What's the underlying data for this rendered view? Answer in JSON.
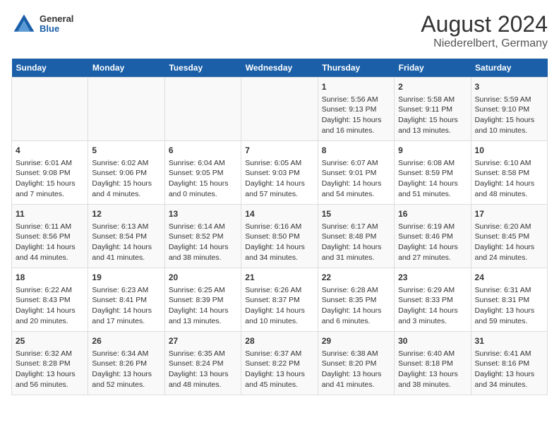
{
  "logo": {
    "general": "General",
    "blue": "Blue"
  },
  "title": "August 2024",
  "subtitle": "Niederelbert, Germany",
  "days_of_week": [
    "Sunday",
    "Monday",
    "Tuesday",
    "Wednesday",
    "Thursday",
    "Friday",
    "Saturday"
  ],
  "weeks": [
    [
      {
        "day": "",
        "info": ""
      },
      {
        "day": "",
        "info": ""
      },
      {
        "day": "",
        "info": ""
      },
      {
        "day": "",
        "info": ""
      },
      {
        "day": "1",
        "info": "Sunrise: 5:56 AM\nSunset: 9:13 PM\nDaylight: 15 hours and 16 minutes."
      },
      {
        "day": "2",
        "info": "Sunrise: 5:58 AM\nSunset: 9:11 PM\nDaylight: 15 hours and 13 minutes."
      },
      {
        "day": "3",
        "info": "Sunrise: 5:59 AM\nSunset: 9:10 PM\nDaylight: 15 hours and 10 minutes."
      }
    ],
    [
      {
        "day": "4",
        "info": "Sunrise: 6:01 AM\nSunset: 9:08 PM\nDaylight: 15 hours and 7 minutes."
      },
      {
        "day": "5",
        "info": "Sunrise: 6:02 AM\nSunset: 9:06 PM\nDaylight: 15 hours and 4 minutes."
      },
      {
        "day": "6",
        "info": "Sunrise: 6:04 AM\nSunset: 9:05 PM\nDaylight: 15 hours and 0 minutes."
      },
      {
        "day": "7",
        "info": "Sunrise: 6:05 AM\nSunset: 9:03 PM\nDaylight: 14 hours and 57 minutes."
      },
      {
        "day": "8",
        "info": "Sunrise: 6:07 AM\nSunset: 9:01 PM\nDaylight: 14 hours and 54 minutes."
      },
      {
        "day": "9",
        "info": "Sunrise: 6:08 AM\nSunset: 8:59 PM\nDaylight: 14 hours and 51 minutes."
      },
      {
        "day": "10",
        "info": "Sunrise: 6:10 AM\nSunset: 8:58 PM\nDaylight: 14 hours and 48 minutes."
      }
    ],
    [
      {
        "day": "11",
        "info": "Sunrise: 6:11 AM\nSunset: 8:56 PM\nDaylight: 14 hours and 44 minutes."
      },
      {
        "day": "12",
        "info": "Sunrise: 6:13 AM\nSunset: 8:54 PM\nDaylight: 14 hours and 41 minutes."
      },
      {
        "day": "13",
        "info": "Sunrise: 6:14 AM\nSunset: 8:52 PM\nDaylight: 14 hours and 38 minutes."
      },
      {
        "day": "14",
        "info": "Sunrise: 6:16 AM\nSunset: 8:50 PM\nDaylight: 14 hours and 34 minutes."
      },
      {
        "day": "15",
        "info": "Sunrise: 6:17 AM\nSunset: 8:48 PM\nDaylight: 14 hours and 31 minutes."
      },
      {
        "day": "16",
        "info": "Sunrise: 6:19 AM\nSunset: 8:46 PM\nDaylight: 14 hours and 27 minutes."
      },
      {
        "day": "17",
        "info": "Sunrise: 6:20 AM\nSunset: 8:45 PM\nDaylight: 14 hours and 24 minutes."
      }
    ],
    [
      {
        "day": "18",
        "info": "Sunrise: 6:22 AM\nSunset: 8:43 PM\nDaylight: 14 hours and 20 minutes."
      },
      {
        "day": "19",
        "info": "Sunrise: 6:23 AM\nSunset: 8:41 PM\nDaylight: 14 hours and 17 minutes."
      },
      {
        "day": "20",
        "info": "Sunrise: 6:25 AM\nSunset: 8:39 PM\nDaylight: 14 hours and 13 minutes."
      },
      {
        "day": "21",
        "info": "Sunrise: 6:26 AM\nSunset: 8:37 PM\nDaylight: 14 hours and 10 minutes."
      },
      {
        "day": "22",
        "info": "Sunrise: 6:28 AM\nSunset: 8:35 PM\nDaylight: 14 hours and 6 minutes."
      },
      {
        "day": "23",
        "info": "Sunrise: 6:29 AM\nSunset: 8:33 PM\nDaylight: 14 hours and 3 minutes."
      },
      {
        "day": "24",
        "info": "Sunrise: 6:31 AM\nSunset: 8:31 PM\nDaylight: 13 hours and 59 minutes."
      }
    ],
    [
      {
        "day": "25",
        "info": "Sunrise: 6:32 AM\nSunset: 8:28 PM\nDaylight: 13 hours and 56 minutes."
      },
      {
        "day": "26",
        "info": "Sunrise: 6:34 AM\nSunset: 8:26 PM\nDaylight: 13 hours and 52 minutes."
      },
      {
        "day": "27",
        "info": "Sunrise: 6:35 AM\nSunset: 8:24 PM\nDaylight: 13 hours and 48 minutes."
      },
      {
        "day": "28",
        "info": "Sunrise: 6:37 AM\nSunset: 8:22 PM\nDaylight: 13 hours and 45 minutes."
      },
      {
        "day": "29",
        "info": "Sunrise: 6:38 AM\nSunset: 8:20 PM\nDaylight: 13 hours and 41 minutes."
      },
      {
        "day": "30",
        "info": "Sunrise: 6:40 AM\nSunset: 8:18 PM\nDaylight: 13 hours and 38 minutes."
      },
      {
        "day": "31",
        "info": "Sunrise: 6:41 AM\nSunset: 8:16 PM\nDaylight: 13 hours and 34 minutes."
      }
    ]
  ]
}
